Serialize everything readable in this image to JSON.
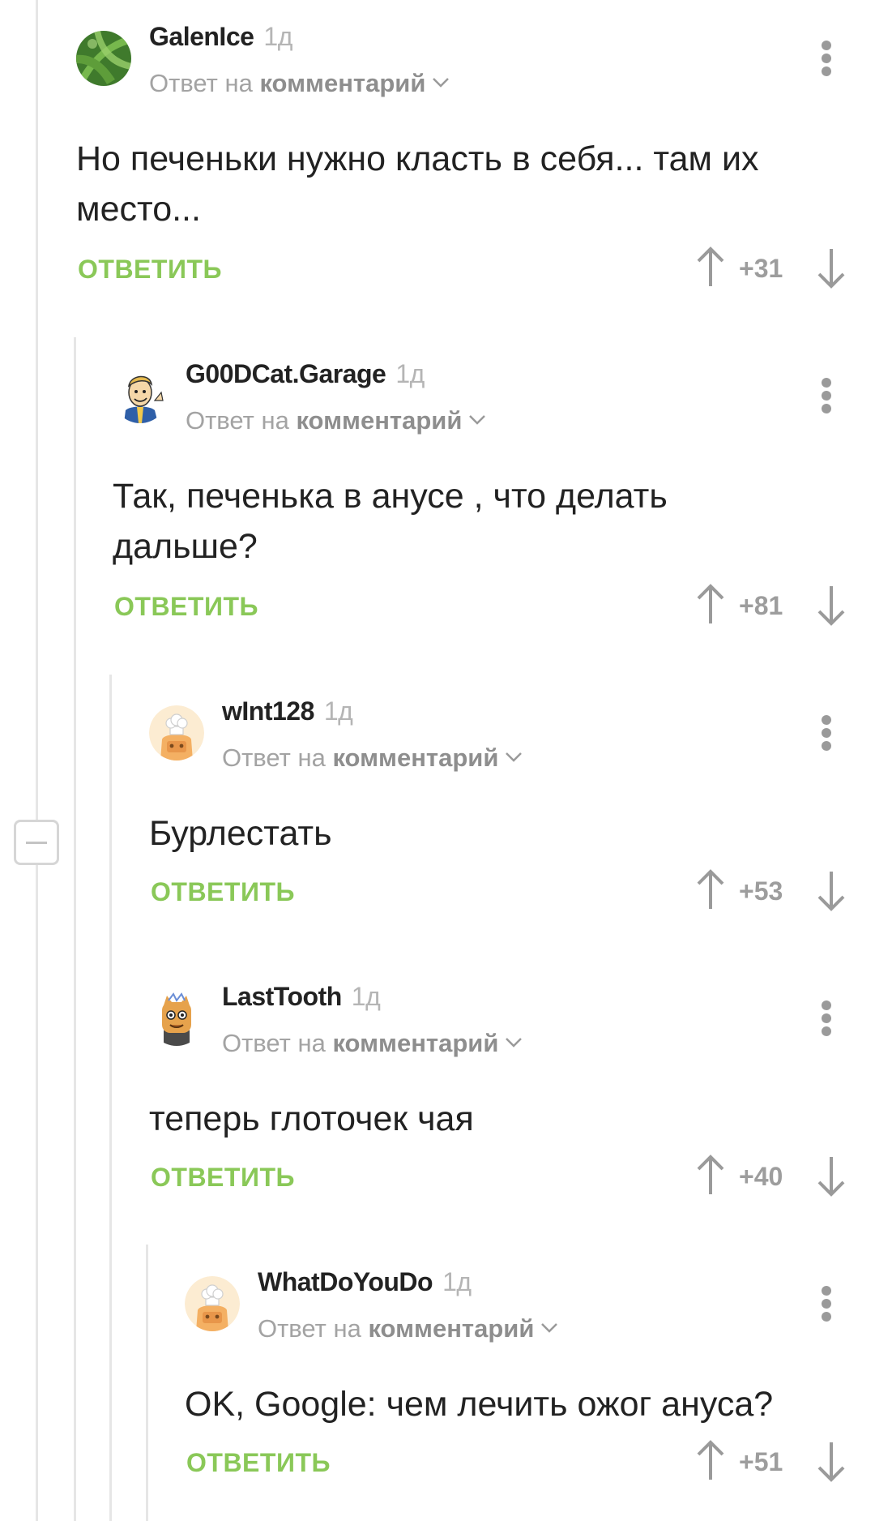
{
  "comments": [
    {
      "author": "GalenIce",
      "time": "1д",
      "reply_prefix": "Ответ на",
      "reply_target": "комментарий",
      "text": "Но печеньки нужно класть в себя... там их место...",
      "reply_label": "ОТВЕТИТЬ",
      "score": "+31",
      "avatar": "leaf-avatar"
    },
    {
      "author": "G00DCat.Garage",
      "time": "1д",
      "reply_prefix": "Ответ на",
      "reply_target": "комментарий",
      "text": "Так, печенька в анусе , что делать дальше?",
      "reply_label": "ОТВЕТИТЬ",
      "score": "+81",
      "avatar": "vault-boy-avatar"
    },
    {
      "author": "wInt128",
      "time": "1д",
      "reply_prefix": "Ответ на",
      "reply_target": "комментарий",
      "text": "Бурлестать",
      "reply_label": "ОТВЕТИТЬ",
      "score": "+53",
      "avatar": "chef-default-avatar"
    },
    {
      "author": "LastTooth",
      "time": "1д",
      "reply_prefix": "Ответ на",
      "reply_target": "комментарий",
      "text": "теперь глоточек чая",
      "reply_label": "ОТВЕТИТЬ",
      "score": "+40",
      "avatar": "cat-character-avatar"
    },
    {
      "author": "WhatDoYouDo",
      "time": "1д",
      "reply_prefix": "Ответ на",
      "reply_target": "комментарий",
      "text": "OK, Google: чем лечить ожог ануса?",
      "reply_label": "ОТВЕТИТЬ",
      "score": "+51",
      "avatar": "chef-default-avatar"
    }
  ],
  "colors": {
    "reply_green": "#8ac858",
    "score_gray": "#9d9d9d",
    "thread_line": "#e6e6e6"
  },
  "icons": [
    "arrow-up-icon",
    "arrow-down-icon",
    "more-vertical-icon",
    "chevron-down-icon",
    "collapse-minus-icon"
  ]
}
